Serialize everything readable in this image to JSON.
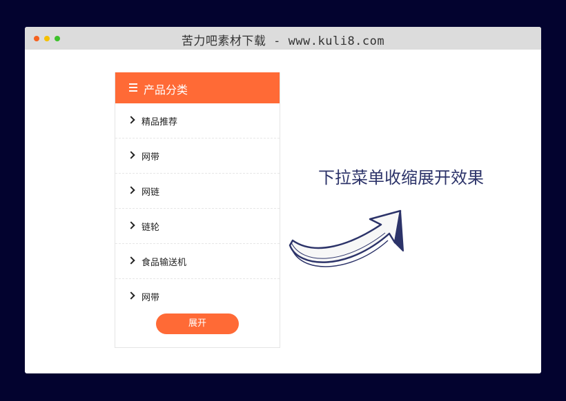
{
  "window": {
    "title": "苦力吧素材下载 - www.kuli8.com",
    "controls": {
      "close_color": "#f5621f",
      "minimize_color": "#f5c000",
      "maximize_color": "#3ec12c"
    }
  },
  "menu": {
    "header_icon": "hamburger-icon",
    "header_title": "产品分类",
    "accent_color": "#ff6a36",
    "items": [
      {
        "label": "精品推荐",
        "icon": "chevron-right-icon"
      },
      {
        "label": "网带",
        "icon": "chevron-right-icon"
      },
      {
        "label": "网链",
        "icon": "chevron-right-icon"
      },
      {
        "label": "链轮",
        "icon": "chevron-right-icon"
      },
      {
        "label": "食品输送机",
        "icon": "chevron-right-icon"
      },
      {
        "label": "网带",
        "icon": "chevron-right-icon"
      }
    ],
    "expand_button": "展开"
  },
  "caption": {
    "text": "下拉菜单收缩展开效果",
    "color": "#2c3369",
    "arrow_icon": "hand-drawn-arrow-icon"
  }
}
